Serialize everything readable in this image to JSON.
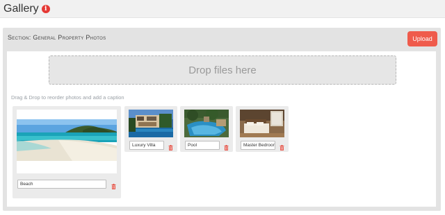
{
  "header": {
    "title": "Gallery",
    "info_icon_glyph": "i"
  },
  "section": {
    "title": "Section: General Property Photos",
    "upload_label": "Upload"
  },
  "dropzone": {
    "label": "Drop files here"
  },
  "hint": "Drag & Drop to reorder photos and add a caption",
  "photos": [
    {
      "caption": "Beach",
      "image": "beach-panorama"
    },
    {
      "caption": "Luxury Villa",
      "image": "villa-exterior"
    },
    {
      "caption": "Pool",
      "image": "pool-area"
    },
    {
      "caption": "Master Bedroom",
      "image": "bedroom-interior"
    }
  ],
  "colors": {
    "accent": "#ef5b4c",
    "info": "#e53935",
    "section_bg": "#e3e3e3"
  }
}
